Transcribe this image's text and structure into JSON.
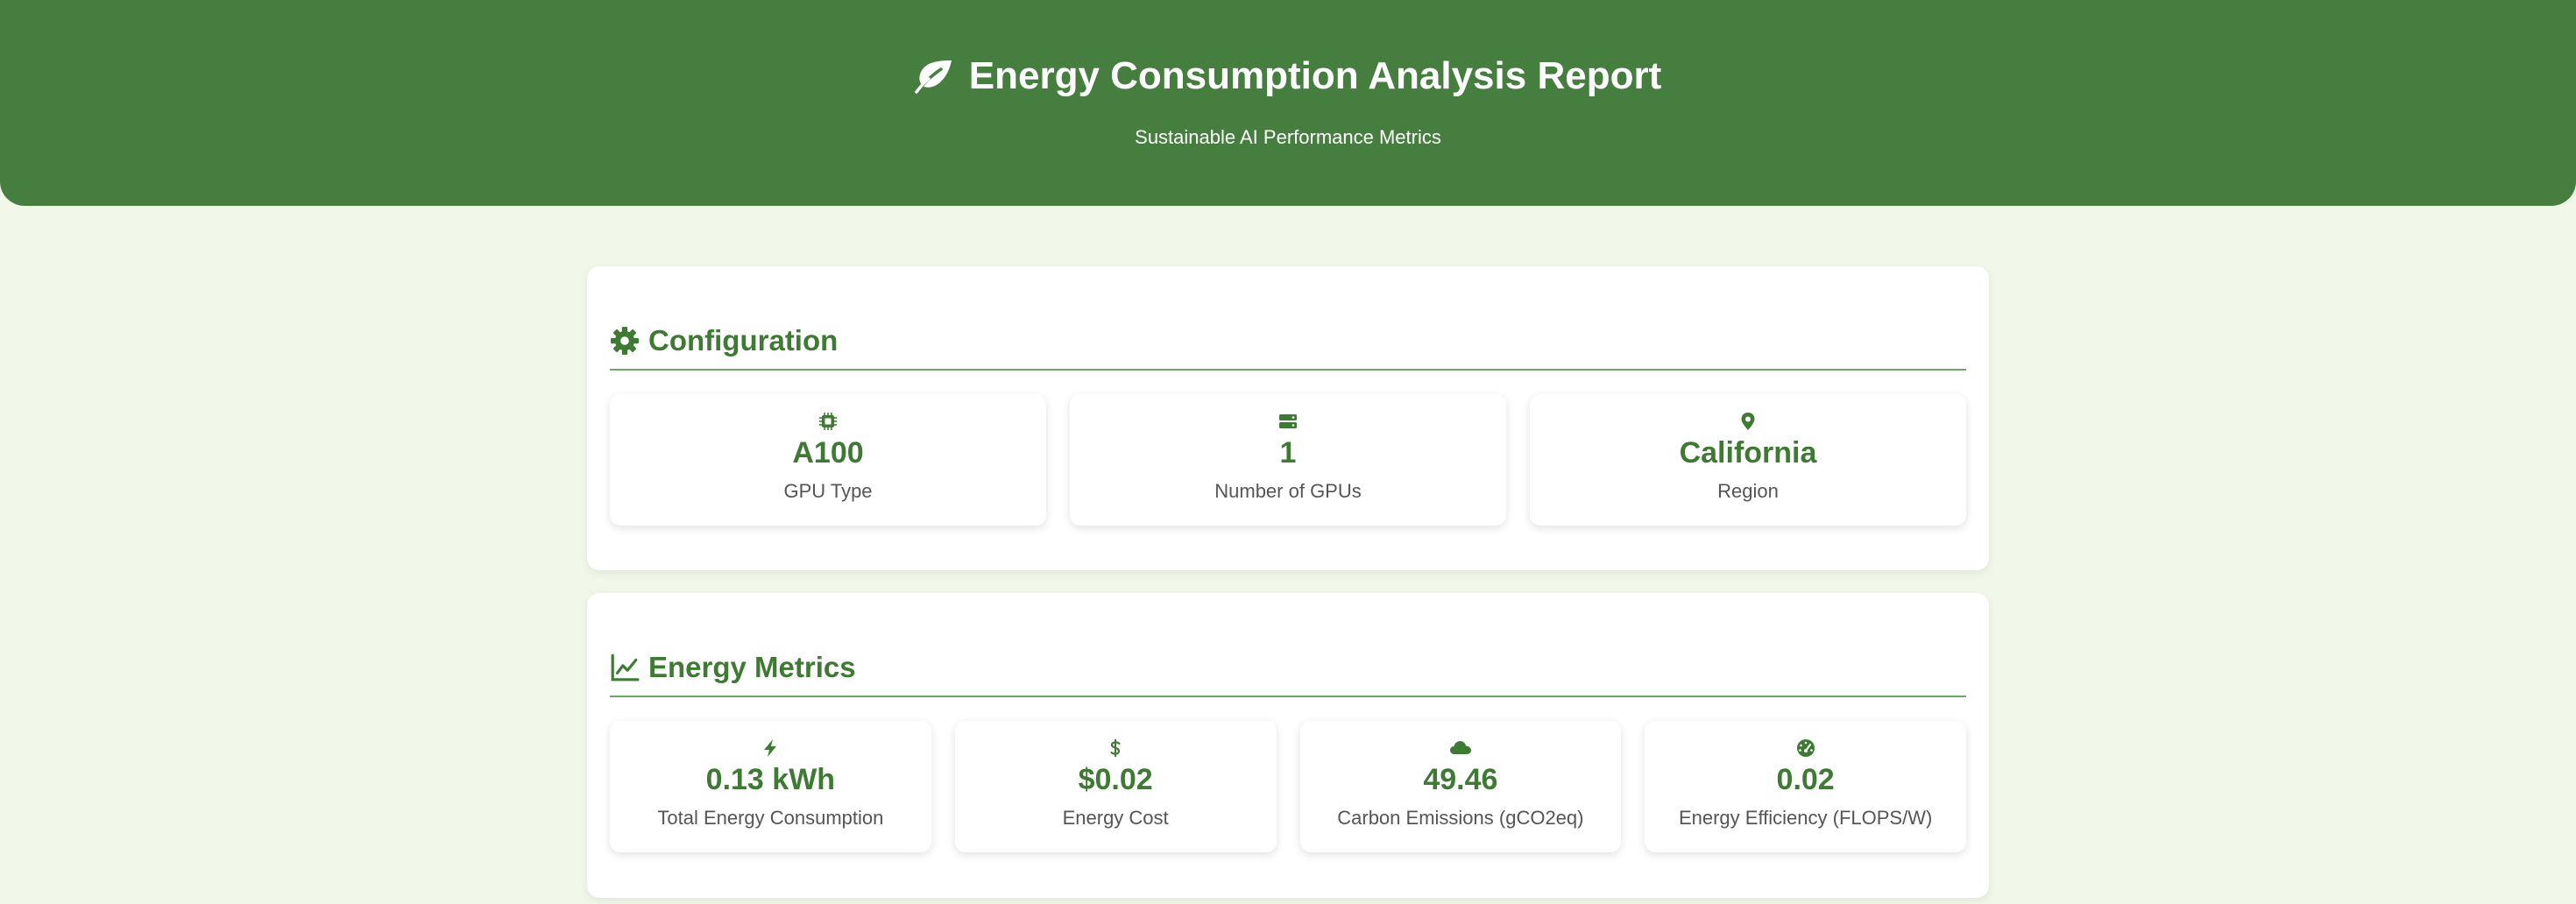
{
  "header": {
    "title": "Energy Consumption Analysis Report",
    "subtitle": "Sustainable AI Performance Metrics",
    "icon": "leaf-icon",
    "background_color": "#457e3e"
  },
  "configuration": {
    "title": "Configuration",
    "icon": "gear-icon",
    "items": [
      {
        "icon": "microchip-icon",
        "value": "A100",
        "label": "GPU Type"
      },
      {
        "icon": "server-icon",
        "value": "1",
        "label": "Number of GPUs"
      },
      {
        "icon": "map-pin-icon",
        "value": "California",
        "label": "Region"
      }
    ]
  },
  "energy_metrics": {
    "title": "Energy Metrics",
    "icon": "line-chart-icon",
    "items": [
      {
        "icon": "bolt-icon",
        "value": "0.13 kWh",
        "label": "Total Energy Consumption"
      },
      {
        "icon": "dollar-icon",
        "value": "$0.02",
        "label": "Energy Cost"
      },
      {
        "icon": "cloud-icon",
        "value": "49.46",
        "label": "Carbon Emissions (gCO2eq)"
      },
      {
        "icon": "gauge-icon",
        "value": "0.02",
        "label": "Energy Efficiency (FLOPS/W)"
      }
    ]
  },
  "colors": {
    "accent": "#3f7a35",
    "page_background": "#f1f8e9",
    "label_text": "#555555"
  }
}
